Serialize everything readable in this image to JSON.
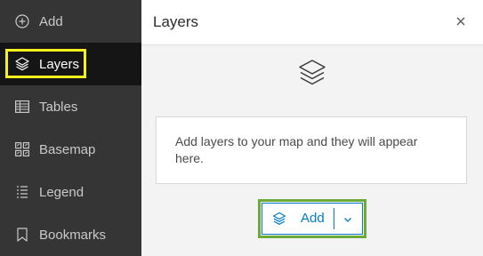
{
  "sidebar": {
    "items": [
      {
        "label": "Add",
        "icon": "plus-circle-icon"
      },
      {
        "label": "Layers",
        "icon": "layers-icon",
        "active": true
      },
      {
        "label": "Tables",
        "icon": "table-icon"
      },
      {
        "label": "Basemap",
        "icon": "basemap-icon"
      },
      {
        "label": "Legend",
        "icon": "legend-icon"
      },
      {
        "label": "Bookmarks",
        "icon": "bookmark-icon"
      }
    ]
  },
  "panel": {
    "title": "Layers",
    "close_icon": "close-icon",
    "empty_icon": "layers-icon",
    "empty_message": "Add layers to your map and they will appear here.",
    "add_button_label": "Add",
    "add_button_icon": "layers-add-icon",
    "dropdown_icon": "chevron-down-icon"
  },
  "colors": {
    "sidebar_bg": "#353535",
    "sidebar_active_bg": "#151515",
    "highlight_yellow": "#f4f21e",
    "highlight_green": "#6cab3a",
    "accent_blue": "#007ac2"
  }
}
